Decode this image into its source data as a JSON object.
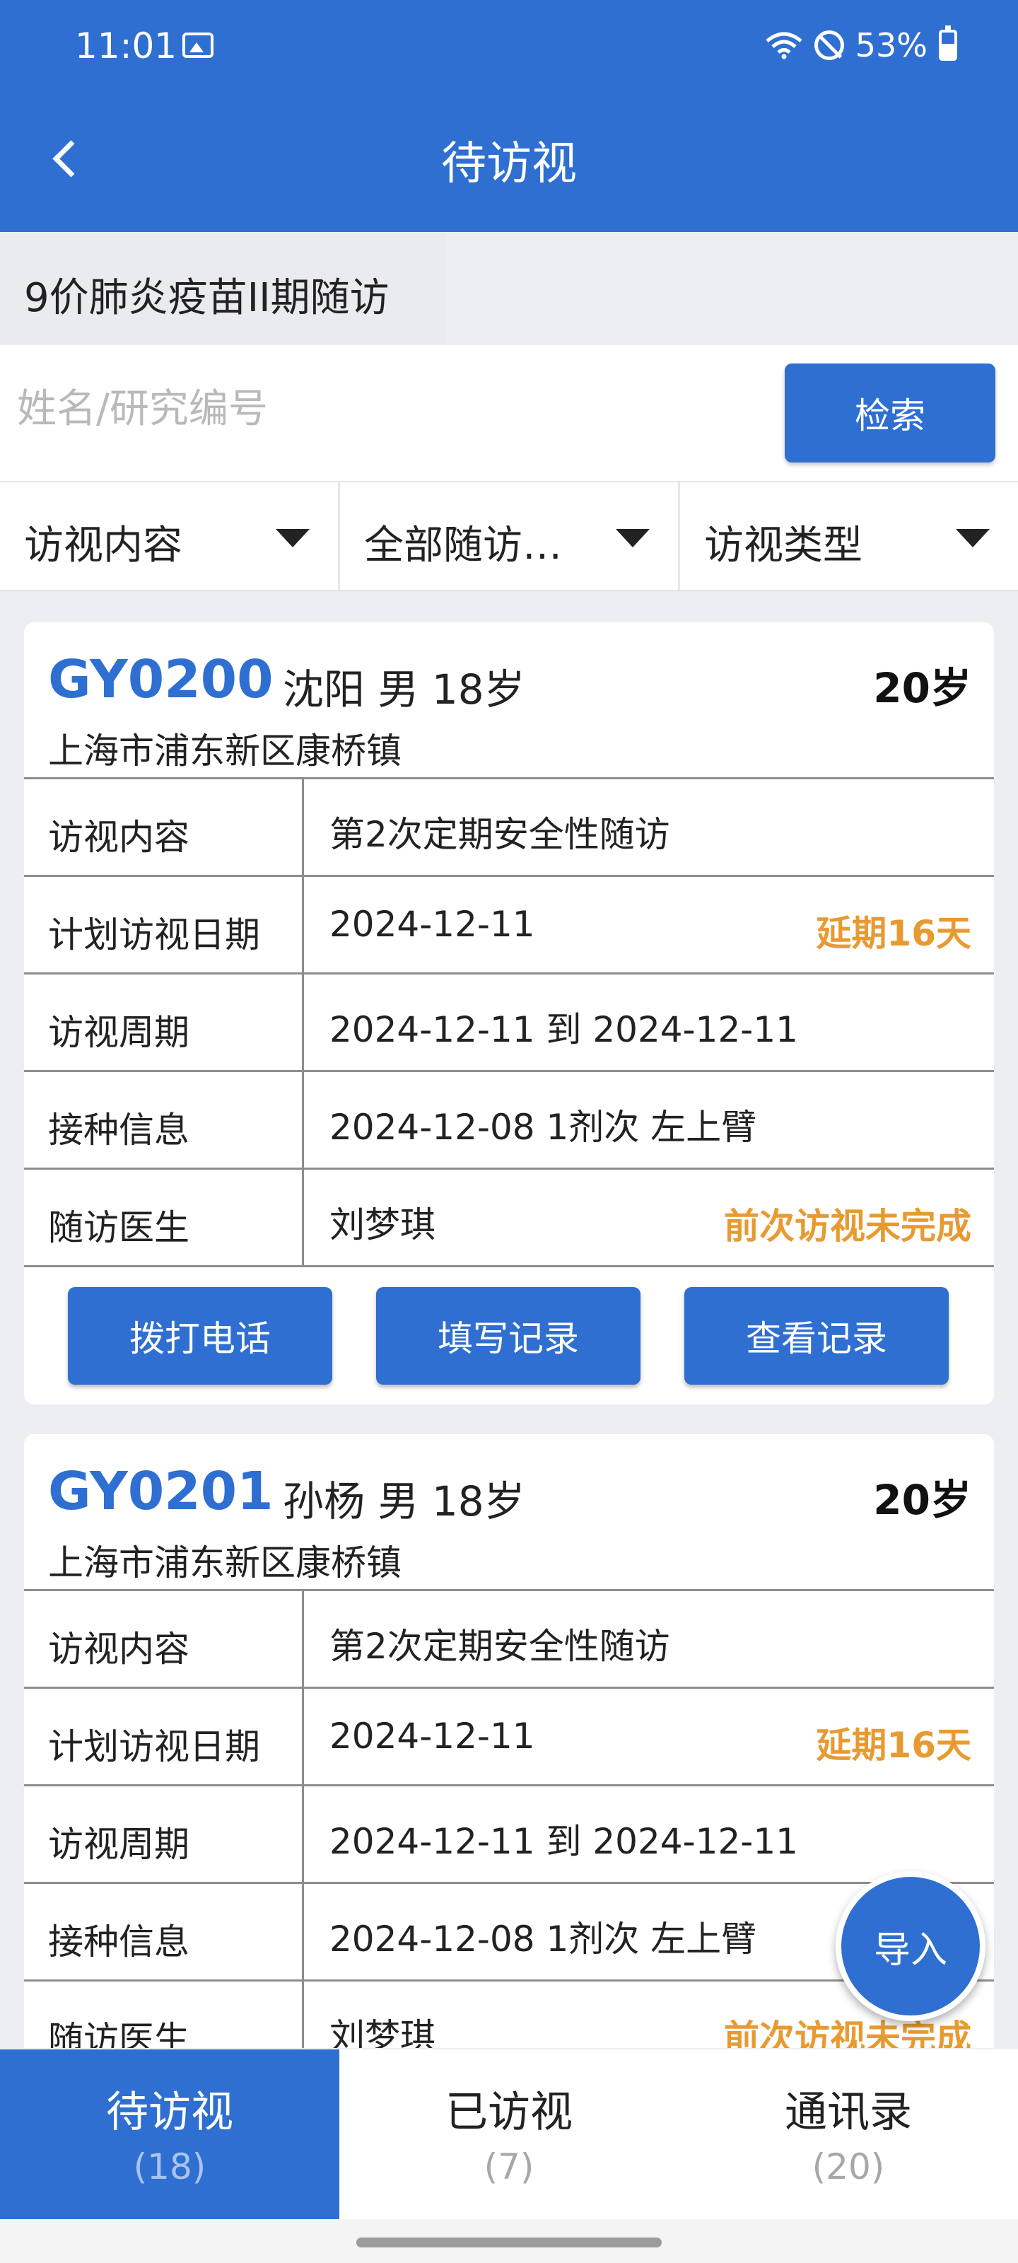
{
  "status_bar": {
    "time": "11:01",
    "battery": "53%"
  },
  "header": {
    "title": "待访视"
  },
  "project": {
    "name": "9价肺炎疫苗II期随访"
  },
  "search": {
    "placeholder": "姓名/研究编号",
    "button_label": "检索"
  },
  "filters": [
    {
      "label": "访视内容"
    },
    {
      "label": "全部随访…"
    },
    {
      "label": "访视类型"
    }
  ],
  "cards": [
    {
      "code": "GY0200",
      "name_gender_age": "沈阳  男  18岁",
      "age_badge": "20岁",
      "address": "上海市浦东新区康桥镇",
      "rows": [
        {
          "label": "访视内容",
          "value": "第2次定期安全性随访",
          "tag": ""
        },
        {
          "label": "计划访视日期",
          "value": "2024-12-11",
          "tag": "延期16天"
        },
        {
          "label": "访视周期",
          "value": "2024-12-11 到 2024-12-11",
          "tag": ""
        },
        {
          "label": "接种信息",
          "value": "2024-12-08 1剂次 左上臂",
          "tag": ""
        },
        {
          "label": "随访医生",
          "value": "刘梦琪",
          "tag": "前次访视未完成"
        }
      ],
      "actions": [
        "拨打电话",
        "填写记录",
        "查看记录"
      ]
    },
    {
      "code": "GY0201",
      "name_gender_age": "孙杨  男  18岁",
      "age_badge": "20岁",
      "address": "上海市浦东新区康桥镇",
      "rows": [
        {
          "label": "访视内容",
          "value": "第2次定期安全性随访",
          "tag": ""
        },
        {
          "label": "计划访视日期",
          "value": "2024-12-11",
          "tag": "延期16天"
        },
        {
          "label": "访视周期",
          "value": "2024-12-11 到 2024-12-11",
          "tag": ""
        },
        {
          "label": "接种信息",
          "value": "2024-12-08 1剂次 左上臂",
          "tag": ""
        },
        {
          "label": "随访医生",
          "value": "刘梦琪",
          "tag": "前次访视未完成"
        }
      ]
    }
  ],
  "fab": {
    "label": "导入"
  },
  "bottom_nav": [
    {
      "label": "待访视",
      "count": "(18)",
      "active": true
    },
    {
      "label": "已访视",
      "count": "(7)",
      "active": false
    },
    {
      "label": "通讯录",
      "count": "(20)",
      "active": false
    }
  ],
  "colors": {
    "primary": "#2f6fd1",
    "warning": "#e89a32",
    "background": "#eceef1"
  },
  "icons": [
    "image-icon",
    "wifi-icon",
    "do-not-disturb-icon",
    "battery-icon",
    "back-arrow-icon",
    "dropdown-caret-icon"
  ]
}
